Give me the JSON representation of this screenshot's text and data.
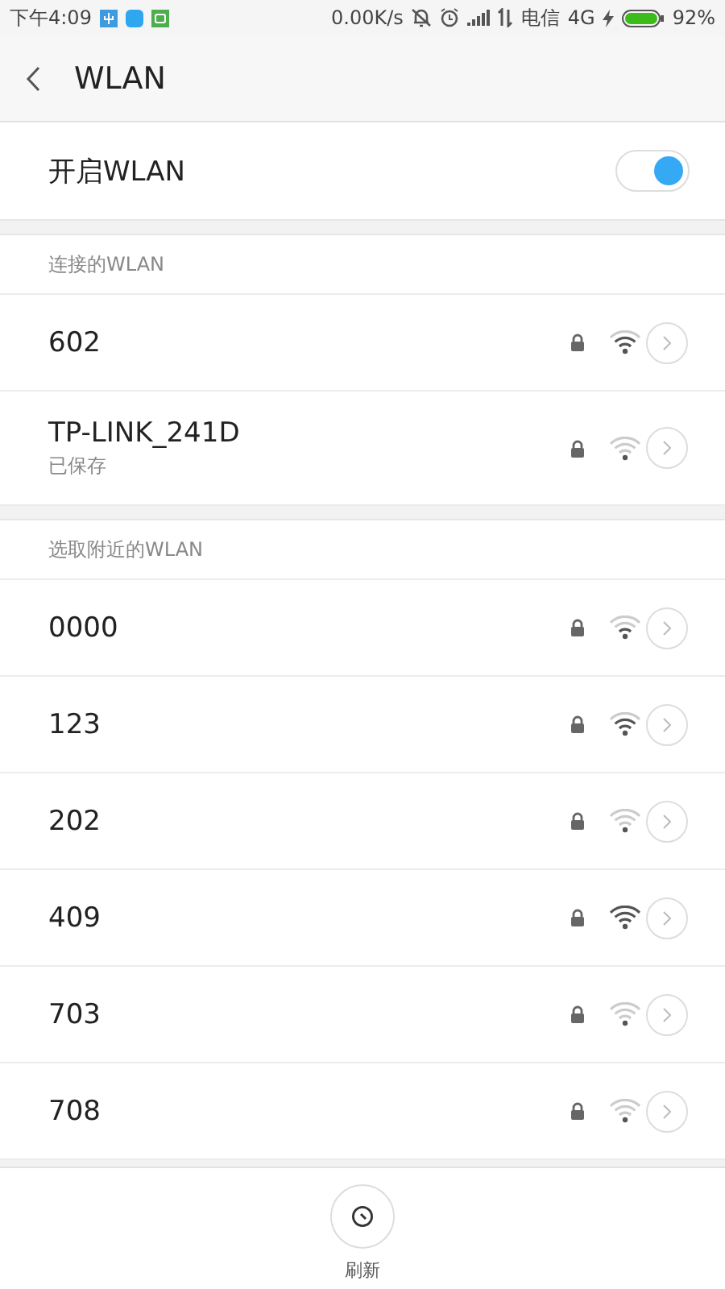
{
  "status_bar": {
    "time": "下午4:09",
    "speed": "0.00K/s",
    "carrier": "电信",
    "network": "4G",
    "battery": "92%"
  },
  "header": {
    "title": "WLAN"
  },
  "wlan_switch": {
    "label": "开启WLAN",
    "on": true
  },
  "sections": [
    {
      "title": "连接的WLAN",
      "networks": [
        {
          "name": "602",
          "kind": "good"
        },
        {
          "name": "TP-LINK_241D",
          "subtitle": "已保存",
          "kind": "weak"
        }
      ]
    },
    {
      "title": "选取附近的WLAN",
      "networks": [
        {
          "name": "0000",
          "kind": "fair"
        },
        {
          "name": "123",
          "kind": "good"
        },
        {
          "name": "202",
          "kind": "weak"
        },
        {
          "name": "409",
          "kind": "strong"
        },
        {
          "name": "703",
          "kind": "weak"
        },
        {
          "name": "708",
          "kind": "weak"
        }
      ]
    }
  ],
  "refresh_button": {
    "label": "刷新"
  }
}
